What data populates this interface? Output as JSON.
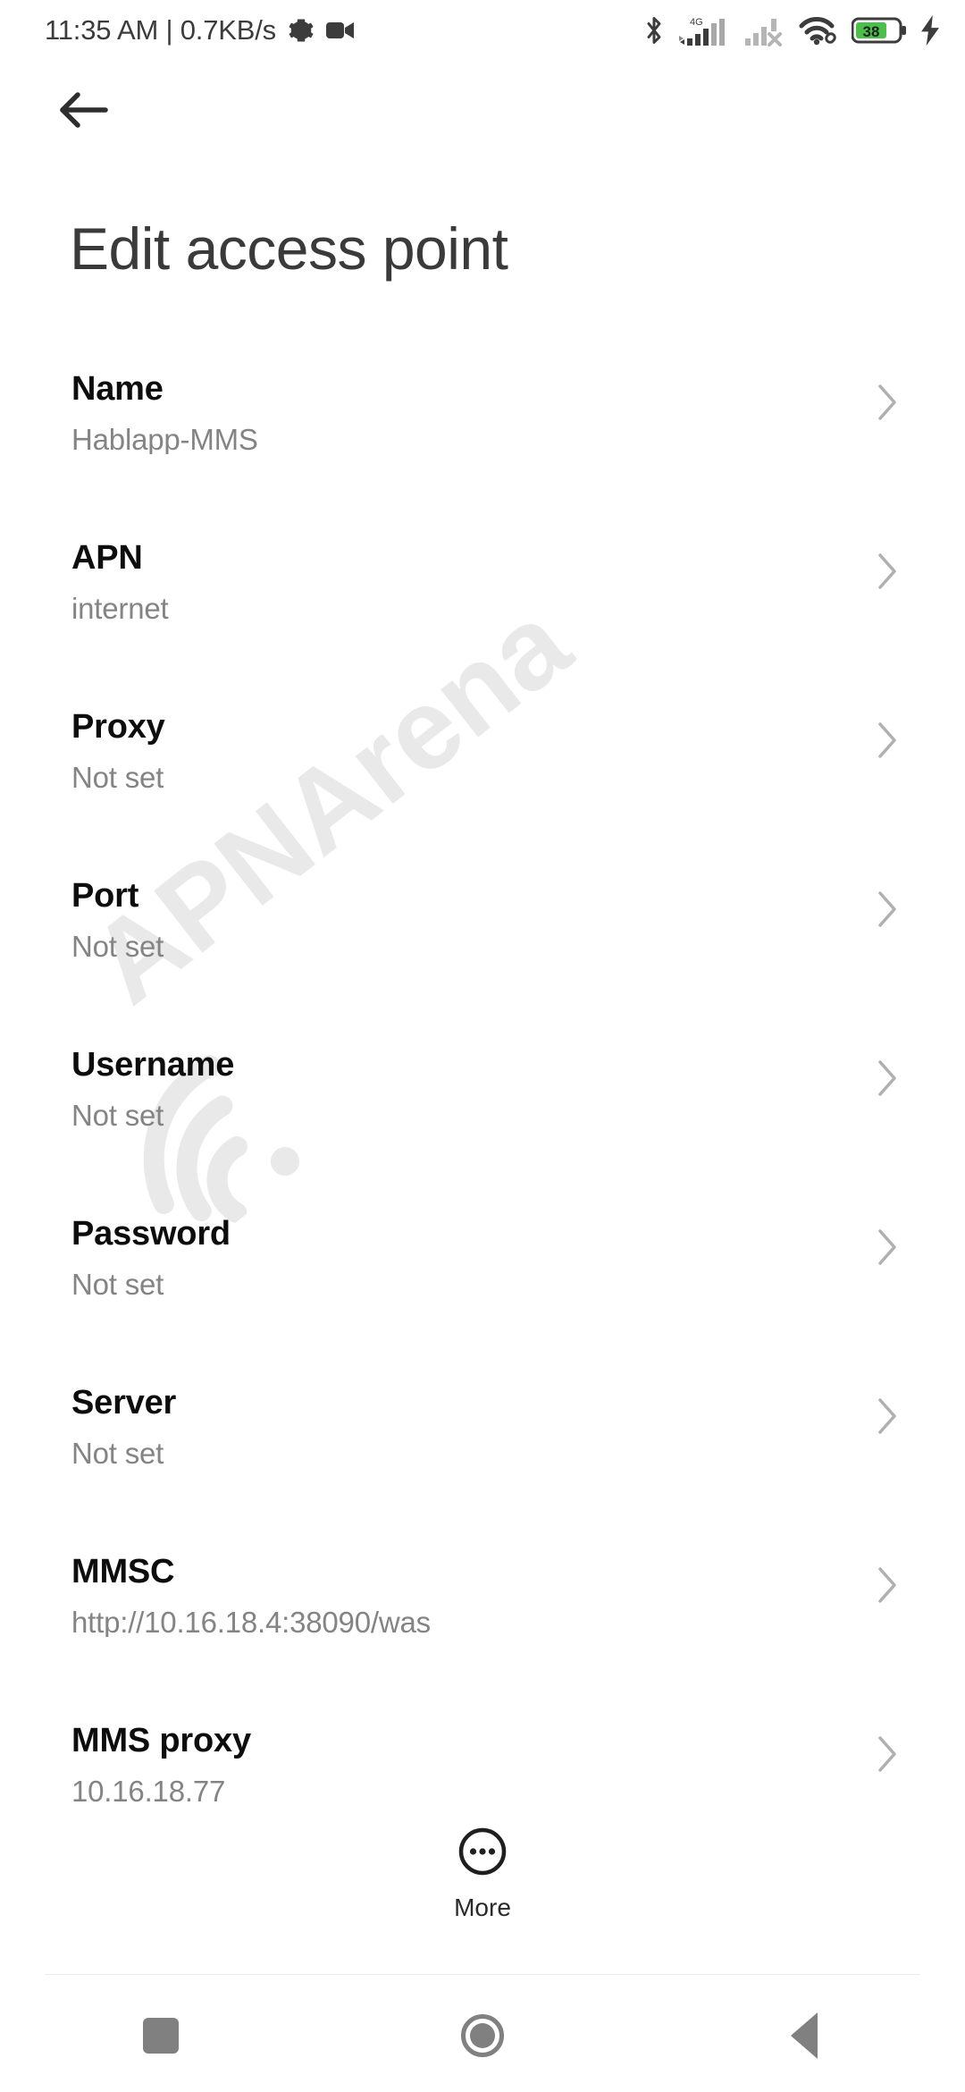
{
  "status_bar": {
    "clock": "11:35 AM | 0.7KB/s",
    "left_icons": [
      "gear-icon",
      "video-camera-icon"
    ],
    "right_icons": [
      "bluetooth-icon",
      "signal-4g-icon",
      "signal-sim2-no-service-icon",
      "wifi-icon",
      "battery-icon",
      "charging-bolt-icon"
    ],
    "network_label": "4G",
    "battery_percent": "38",
    "battery_color": "#4ac04a"
  },
  "appbar": {
    "back_label": "Back"
  },
  "header": {
    "title": "Edit access point"
  },
  "watermark": {
    "text": "APNArena",
    "color": "#e9e9e9"
  },
  "list": {
    "items": [
      {
        "title": "Name",
        "value": "Hablapp-MMS"
      },
      {
        "title": "APN",
        "value": "internet"
      },
      {
        "title": "Proxy",
        "value": "Not set"
      },
      {
        "title": "Port",
        "value": "Not set"
      },
      {
        "title": "Username",
        "value": "Not set"
      },
      {
        "title": "Password",
        "value": "Not set"
      },
      {
        "title": "Server",
        "value": "Not set"
      },
      {
        "title": "MMSC",
        "value": "http://10.16.18.4:38090/was"
      },
      {
        "title": "MMS proxy",
        "value": "10.16.18.77"
      }
    ]
  },
  "more_button": {
    "label": "More"
  },
  "nav_bar": {
    "recents_label": "Recents",
    "home_label": "Home",
    "back_label": "Back"
  }
}
